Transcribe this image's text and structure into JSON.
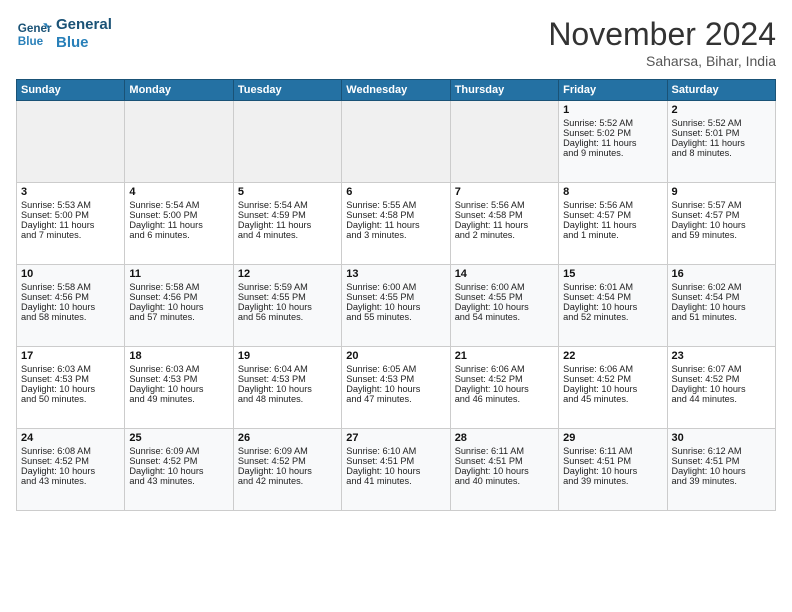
{
  "header": {
    "logo_line1": "General",
    "logo_line2": "Blue",
    "month": "November 2024",
    "location": "Saharsa, Bihar, India"
  },
  "days_of_week": [
    "Sunday",
    "Monday",
    "Tuesday",
    "Wednesday",
    "Thursday",
    "Friday",
    "Saturday"
  ],
  "weeks": [
    [
      {
        "num": "",
        "data": ""
      },
      {
        "num": "",
        "data": ""
      },
      {
        "num": "",
        "data": ""
      },
      {
        "num": "",
        "data": ""
      },
      {
        "num": "",
        "data": ""
      },
      {
        "num": "1",
        "data": "Sunrise: 5:52 AM\nSunset: 5:02 PM\nDaylight: 11 hours\nand 9 minutes."
      },
      {
        "num": "2",
        "data": "Sunrise: 5:52 AM\nSunset: 5:01 PM\nDaylight: 11 hours\nand 8 minutes."
      }
    ],
    [
      {
        "num": "3",
        "data": "Sunrise: 5:53 AM\nSunset: 5:00 PM\nDaylight: 11 hours\nand 7 minutes."
      },
      {
        "num": "4",
        "data": "Sunrise: 5:54 AM\nSunset: 5:00 PM\nDaylight: 11 hours\nand 6 minutes."
      },
      {
        "num": "5",
        "data": "Sunrise: 5:54 AM\nSunset: 4:59 PM\nDaylight: 11 hours\nand 4 minutes."
      },
      {
        "num": "6",
        "data": "Sunrise: 5:55 AM\nSunset: 4:58 PM\nDaylight: 11 hours\nand 3 minutes."
      },
      {
        "num": "7",
        "data": "Sunrise: 5:56 AM\nSunset: 4:58 PM\nDaylight: 11 hours\nand 2 minutes."
      },
      {
        "num": "8",
        "data": "Sunrise: 5:56 AM\nSunset: 4:57 PM\nDaylight: 11 hours\nand 1 minute."
      },
      {
        "num": "9",
        "data": "Sunrise: 5:57 AM\nSunset: 4:57 PM\nDaylight: 10 hours\nand 59 minutes."
      }
    ],
    [
      {
        "num": "10",
        "data": "Sunrise: 5:58 AM\nSunset: 4:56 PM\nDaylight: 10 hours\nand 58 minutes."
      },
      {
        "num": "11",
        "data": "Sunrise: 5:58 AM\nSunset: 4:56 PM\nDaylight: 10 hours\nand 57 minutes."
      },
      {
        "num": "12",
        "data": "Sunrise: 5:59 AM\nSunset: 4:55 PM\nDaylight: 10 hours\nand 56 minutes."
      },
      {
        "num": "13",
        "data": "Sunrise: 6:00 AM\nSunset: 4:55 PM\nDaylight: 10 hours\nand 55 minutes."
      },
      {
        "num": "14",
        "data": "Sunrise: 6:00 AM\nSunset: 4:55 PM\nDaylight: 10 hours\nand 54 minutes."
      },
      {
        "num": "15",
        "data": "Sunrise: 6:01 AM\nSunset: 4:54 PM\nDaylight: 10 hours\nand 52 minutes."
      },
      {
        "num": "16",
        "data": "Sunrise: 6:02 AM\nSunset: 4:54 PM\nDaylight: 10 hours\nand 51 minutes."
      }
    ],
    [
      {
        "num": "17",
        "data": "Sunrise: 6:03 AM\nSunset: 4:53 PM\nDaylight: 10 hours\nand 50 minutes."
      },
      {
        "num": "18",
        "data": "Sunrise: 6:03 AM\nSunset: 4:53 PM\nDaylight: 10 hours\nand 49 minutes."
      },
      {
        "num": "19",
        "data": "Sunrise: 6:04 AM\nSunset: 4:53 PM\nDaylight: 10 hours\nand 48 minutes."
      },
      {
        "num": "20",
        "data": "Sunrise: 6:05 AM\nSunset: 4:53 PM\nDaylight: 10 hours\nand 47 minutes."
      },
      {
        "num": "21",
        "data": "Sunrise: 6:06 AM\nSunset: 4:52 PM\nDaylight: 10 hours\nand 46 minutes."
      },
      {
        "num": "22",
        "data": "Sunrise: 6:06 AM\nSunset: 4:52 PM\nDaylight: 10 hours\nand 45 minutes."
      },
      {
        "num": "23",
        "data": "Sunrise: 6:07 AM\nSunset: 4:52 PM\nDaylight: 10 hours\nand 44 minutes."
      }
    ],
    [
      {
        "num": "24",
        "data": "Sunrise: 6:08 AM\nSunset: 4:52 PM\nDaylight: 10 hours\nand 43 minutes."
      },
      {
        "num": "25",
        "data": "Sunrise: 6:09 AM\nSunset: 4:52 PM\nDaylight: 10 hours\nand 43 minutes."
      },
      {
        "num": "26",
        "data": "Sunrise: 6:09 AM\nSunset: 4:52 PM\nDaylight: 10 hours\nand 42 minutes."
      },
      {
        "num": "27",
        "data": "Sunrise: 6:10 AM\nSunset: 4:51 PM\nDaylight: 10 hours\nand 41 minutes."
      },
      {
        "num": "28",
        "data": "Sunrise: 6:11 AM\nSunset: 4:51 PM\nDaylight: 10 hours\nand 40 minutes."
      },
      {
        "num": "29",
        "data": "Sunrise: 6:11 AM\nSunset: 4:51 PM\nDaylight: 10 hours\nand 39 minutes."
      },
      {
        "num": "30",
        "data": "Sunrise: 6:12 AM\nSunset: 4:51 PM\nDaylight: 10 hours\nand 39 minutes."
      }
    ]
  ]
}
